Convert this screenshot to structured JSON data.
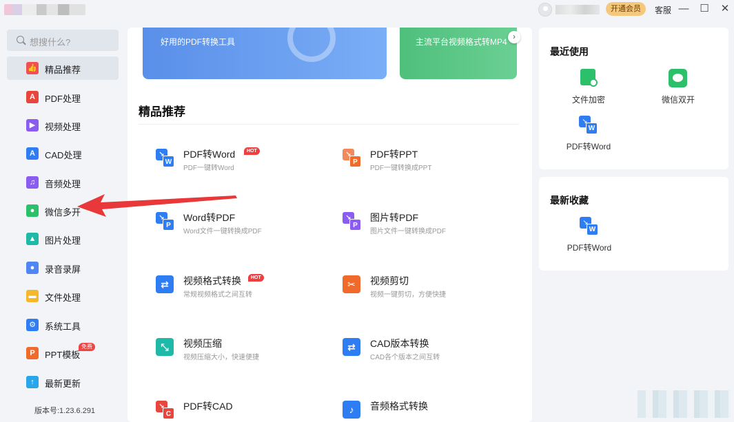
{
  "titlebar": {
    "vip_label": "开通会员",
    "service_label": "客服",
    "minimize": "—",
    "maximize": "☐",
    "close": "✕"
  },
  "sidebar": {
    "search_placeholder": "想搜什么?",
    "items": [
      {
        "label": "精品推荐",
        "icon": "thumbs-up-icon",
        "color": "#f0504f"
      },
      {
        "label": "PDF处理",
        "icon": "pdf-icon",
        "color": "#e8463c"
      },
      {
        "label": "视频处理",
        "icon": "play-icon",
        "color": "#8a5cf0"
      },
      {
        "label": "CAD处理",
        "icon": "cad-icon",
        "color": "#2f7df2"
      },
      {
        "label": "音频处理",
        "icon": "music-icon",
        "color": "#8a5cf0"
      },
      {
        "label": "微信多开",
        "icon": "wechat-icon",
        "color": "#2cc06b"
      },
      {
        "label": "图片处理",
        "icon": "image-icon",
        "color": "#1fb9a8"
      },
      {
        "label": "录音录屏",
        "icon": "microphone-icon",
        "color": "#4f86f5"
      },
      {
        "label": "文件处理",
        "icon": "folder-icon",
        "color": "#f5b72c"
      },
      {
        "label": "系统工具",
        "icon": "gear-icon",
        "color": "#2f7df2"
      },
      {
        "label": "PPT模板",
        "icon": "ppt-icon",
        "color": "#f06a2c",
        "badge": "免费"
      },
      {
        "label": "最新更新",
        "icon": "upload-icon",
        "color": "#2aa6e8"
      }
    ],
    "version": "版本号:1.23.6.291"
  },
  "main": {
    "banners": [
      {
        "text": "好用的PDF转换工具"
      },
      {
        "text": "主流平台视频格式转MP4"
      }
    ],
    "section_title": "精品推荐",
    "tools": [
      {
        "name": "PDF转Word",
        "desc": "PDF一键转Word",
        "hot": "HOT"
      },
      {
        "name": "PDF转PPT",
        "desc": "PDF一键转换成PPT"
      },
      {
        "name": "Word转PDF",
        "desc": "Word文件一键转换成PDF"
      },
      {
        "name": "图片转PDF",
        "desc": "图片文件一键转换成PDF"
      },
      {
        "name": "视频格式转换",
        "desc": "常规视频格式之间互转",
        "hot": "HOT"
      },
      {
        "name": "视频剪切",
        "desc": "视频一键剪切，方便快捷"
      },
      {
        "name": "视频压缩",
        "desc": "视频压缩大小，快速便捷"
      },
      {
        "name": "CAD版本转换",
        "desc": "CAD各个版本之间互转"
      },
      {
        "name": "PDF转CAD",
        "desc": ""
      },
      {
        "name": "音频格式转换",
        "desc": ""
      }
    ]
  },
  "recent": {
    "title": "最近使用",
    "items": [
      {
        "label": "文件加密"
      },
      {
        "label": "微信双开"
      },
      {
        "label": "PDF转Word"
      }
    ]
  },
  "favorites": {
    "title": "最新收藏",
    "items": [
      {
        "label": "PDF转Word"
      }
    ]
  },
  "colors": {
    "accent_blue": "#2f7df2",
    "pdf_red": "#e8463c",
    "ppt_orange": "#f06a2c",
    "hot_red": "#f03e3e",
    "vip_gold": "#f5c97d",
    "wechat_green": "#2cc06b",
    "annotation_arrow": "#e8383a"
  }
}
